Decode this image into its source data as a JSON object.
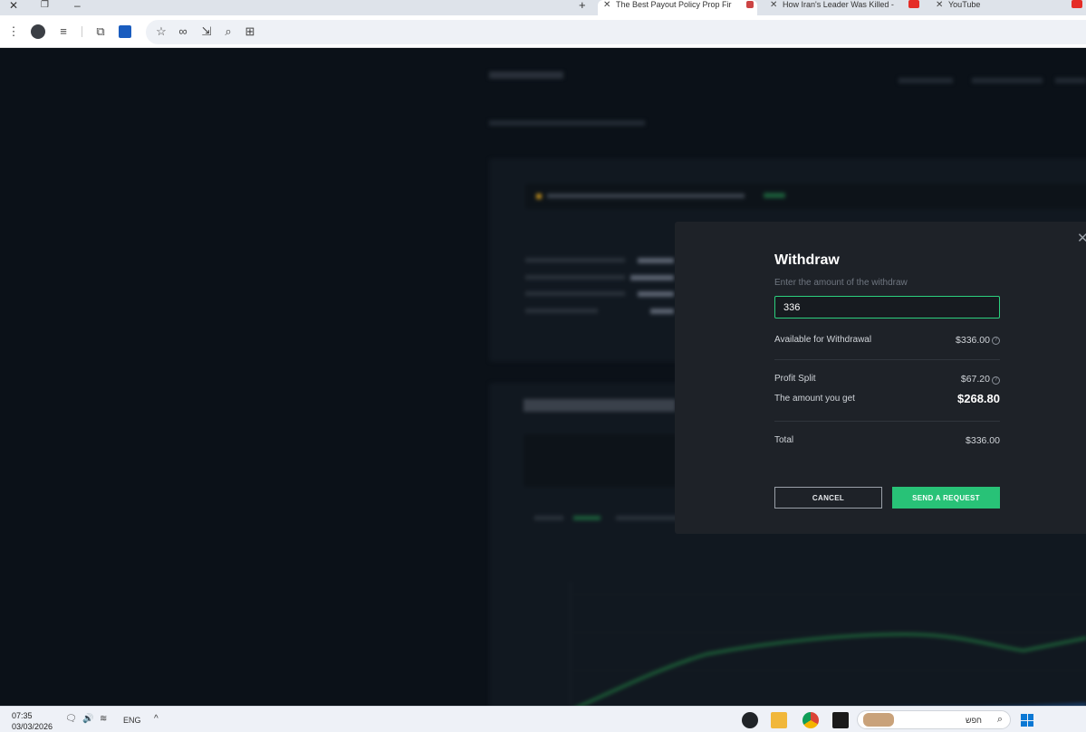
{
  "browser": {
    "tabs": [
      {
        "title": "The Best Payout Policy Prop Fir",
        "active": true
      },
      {
        "title": "How Iran's Leader Was Killed -",
        "active": false
      },
      {
        "title": "YouTube",
        "active": false
      }
    ],
    "new_tab_symbol": "+"
  },
  "modal": {
    "title": "Withdraw",
    "subtitle": "Enter the amount of the withdraw",
    "amount_value": "336",
    "available_label": "Available for Withdrawal",
    "available_value": "$336.00",
    "profit_split_label": "Profit Split",
    "profit_split_value": "$67.20",
    "amount_get_label": "The amount you get",
    "amount_get_value": "$268.80",
    "total_label": "Total",
    "total_value": "$336.00",
    "cancel_label": "CANCEL",
    "send_label": "SEND A REQUEST",
    "help_symbol": "?",
    "close_symbol": "✕"
  },
  "taskbar": {
    "time": "07:35",
    "date": "03/03/2026",
    "language": "ENG",
    "search_text": "חפש"
  },
  "colors": {
    "accent": "#28c277",
    "input_border": "#2bd07e",
    "modal_bg": "#1e2228",
    "page_bg": "#0b1118"
  }
}
